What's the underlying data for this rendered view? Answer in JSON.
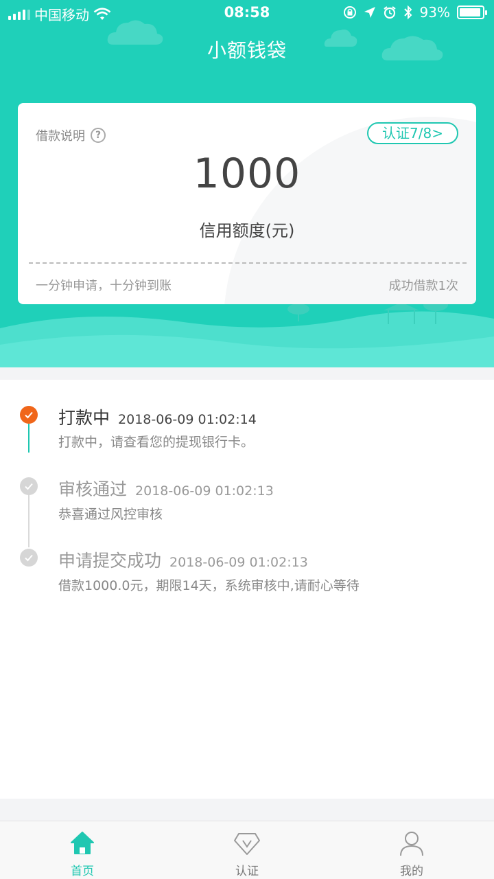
{
  "status_bar": {
    "carrier": "中国移动",
    "time": "08:58",
    "battery": "93%",
    "battery_level": 0.93
  },
  "nav": {
    "title": "小额钱袋"
  },
  "card": {
    "explain_label": "借款说明",
    "help_icon": "question-circle-icon",
    "cert_badge": "认证7/8>",
    "amount": "1000",
    "amount_label": "信用额度(元)",
    "footer_left": "一分钟申请，十分钟到账",
    "footer_right": "成功借款1次"
  },
  "timeline": [
    {
      "title": "打款中",
      "time": "2018-06-09 01:02:14",
      "desc": "打款中，请查看您的提现银行卡。",
      "state": "active"
    },
    {
      "title": "审核通过",
      "time": "2018-06-09 01:02:13",
      "desc": "恭喜通过风控审核",
      "state": "done"
    },
    {
      "title": "申请提交成功",
      "time": "2018-06-09 01:02:13",
      "desc": "借款1000.0元，期限14天，系统审核中,请耐心等待",
      "state": "done"
    }
  ],
  "tabs": [
    {
      "label": "首页",
      "icon": "home-icon",
      "active": true
    },
    {
      "label": "认证",
      "icon": "diamond-badge-icon",
      "active": false
    },
    {
      "label": "我的",
      "icon": "person-icon",
      "active": false
    }
  ],
  "colors": {
    "brand": "#1fd0b9",
    "accent_text": "#1fc7b1",
    "active_step": "#f0661a",
    "inactive_step": "#d6d6d6"
  }
}
